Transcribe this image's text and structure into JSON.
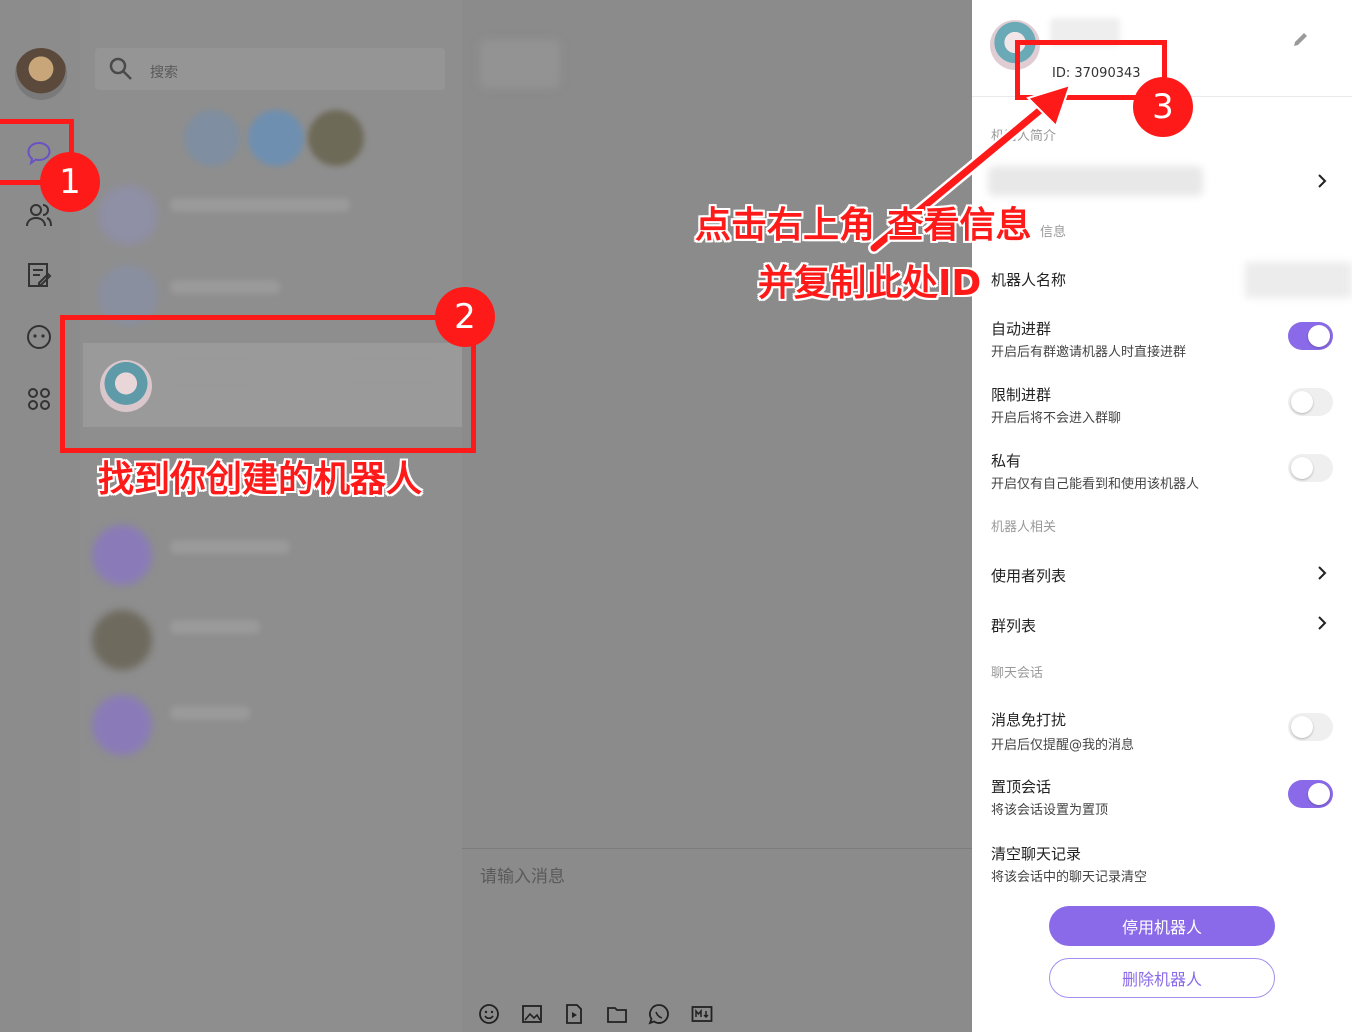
{
  "sidebar": {
    "icons": [
      "chat-icon",
      "contacts-icon",
      "notes-icon",
      "robot-icon",
      "apps-icon"
    ]
  },
  "chat_list": {
    "search_placeholder": "搜索"
  },
  "chat": {
    "input_placeholder": "请输入消息",
    "toolbar_icons": [
      "emoji-icon",
      "image-icon",
      "file-icon",
      "folder-icon",
      "voice-icon",
      "markdown-icon"
    ]
  },
  "panel": {
    "id_text": "ID: 37090343",
    "intro_label": "机器人简介",
    "info_label_visible": "信息",
    "name_label": "机器人名称",
    "auto_join": {
      "title": "自动进群",
      "desc": "开启后有群邀请机器人时直接进群",
      "on": true
    },
    "limit_join": {
      "title": "限制进群",
      "desc": "开启后将不会进入群聊",
      "on": false
    },
    "private": {
      "title": "私有",
      "desc": "开启仅有自己能看到和使用该机器人",
      "on": false
    },
    "related_label": "机器人相关",
    "users_list": "使用者列表",
    "group_list": "群列表",
    "session_label": "聊天会话",
    "mute": {
      "title": "消息免打扰",
      "desc": "开启后仅提醒@我的消息",
      "on": false
    },
    "pin": {
      "title": "置顶会话",
      "desc": "将该会话设置为置顶",
      "on": true
    },
    "clear": {
      "title": "清空聊天记录",
      "desc": "将该会话中的聊天记录清空"
    },
    "disable_button": "停用机器人",
    "delete_button": "删除机器人",
    "accent_color": "#8a6ae8"
  },
  "annotations": {
    "badge1": "1",
    "badge2": "2",
    "badge3": "3",
    "callout_find": "找到你创建的机器人",
    "callout_click": "点击右上角 查看信息",
    "callout_copy": "并复制此处ID",
    "color": "#ff1a1a"
  }
}
